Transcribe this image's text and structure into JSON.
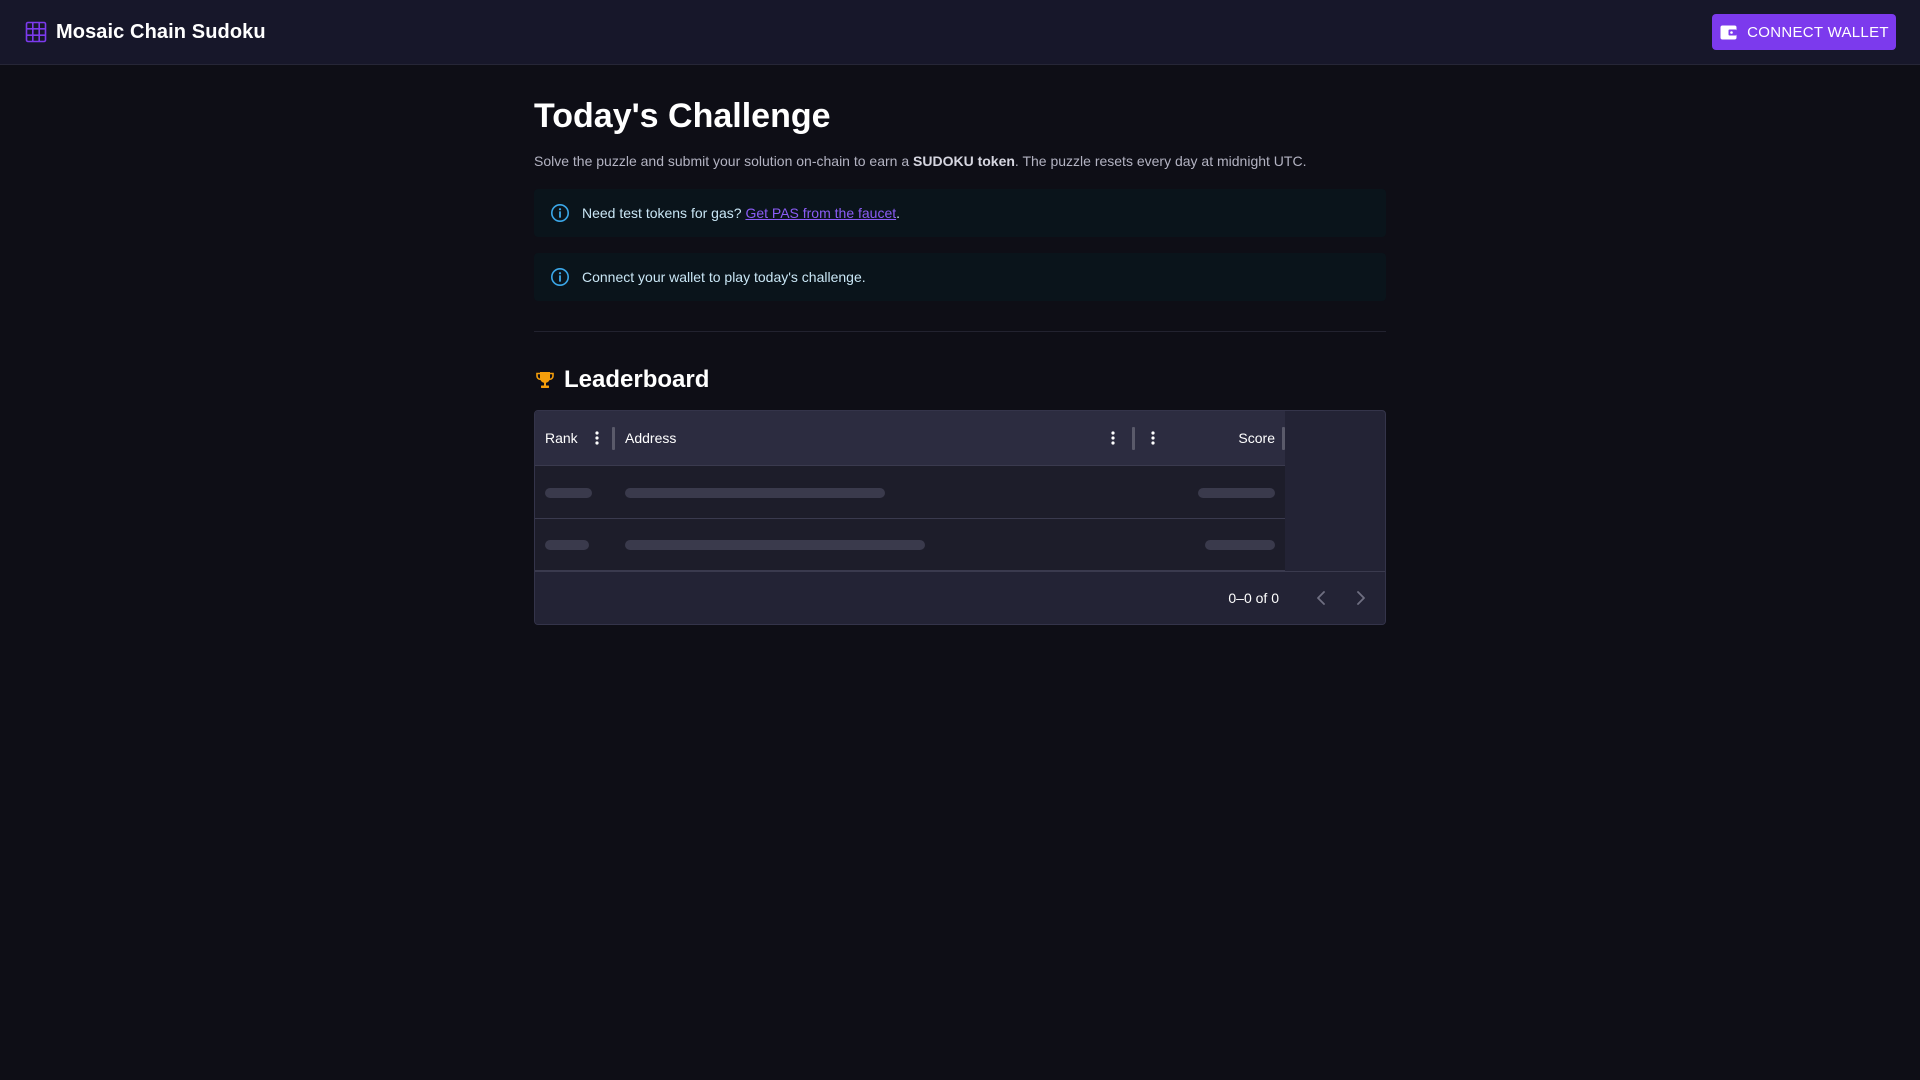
{
  "app": {
    "title": "Mosaic Chain Sudoku",
    "logo_icon": "grid-icon",
    "accent_color": "#7c3aed"
  },
  "header": {
    "connect_button_label": "CONNECT WALLET",
    "connect_button_icon": "wallet-icon"
  },
  "challenge": {
    "title": "Today's Challenge",
    "subtitle_before": "Solve the puzzle and submit your solution on-chain to earn a ",
    "subtitle_strong": "SUDOKU token",
    "subtitle_after": ". The puzzle resets every day at midnight UTC."
  },
  "alerts": {
    "faucet": {
      "text_before": "Need test tokens for gas? ",
      "link_text": "Get PAS from the faucet",
      "text_after": ".",
      "icon": "info-icon"
    },
    "connect": {
      "text": "Connect your wallet to play today's challenge.",
      "icon": "info-icon"
    }
  },
  "leaderboard": {
    "title": "Leaderboard",
    "icon": "trophy-icon",
    "columns": {
      "rank": "Rank",
      "address": "Address",
      "score": "Score"
    },
    "pagination": {
      "range_text": "0–0 of 0"
    }
  }
}
